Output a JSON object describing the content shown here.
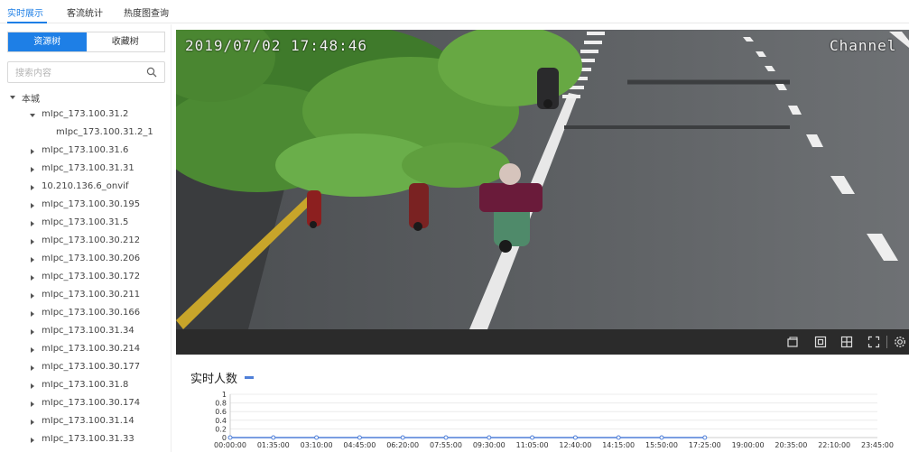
{
  "nav": {
    "tabs": [
      {
        "label": "实时展示",
        "active": true
      },
      {
        "label": "客流统计",
        "active": false
      },
      {
        "label": "热度图查询",
        "active": false
      }
    ]
  },
  "sidebar": {
    "segments": [
      {
        "label": "资源树",
        "active": true
      },
      {
        "label": "收藏树",
        "active": false
      }
    ],
    "search": {
      "placeholder": "搜索内容"
    },
    "tree": [
      {
        "label": "本城",
        "level": 0,
        "expanded": true
      },
      {
        "label": "mIpc_173.100.31.2",
        "level": 1,
        "expanded": true
      },
      {
        "label": "mIpc_173.100.31.2_1",
        "level": 2,
        "leaf": true
      },
      {
        "label": "mIpc_173.100.31.6",
        "level": 1
      },
      {
        "label": "mIpc_173.100.31.31",
        "level": 1
      },
      {
        "label": "10.210.136.6_onvif",
        "level": 1
      },
      {
        "label": "mIpc_173.100.30.195",
        "level": 1
      },
      {
        "label": "mIpc_173.100.31.5",
        "level": 1
      },
      {
        "label": "mIpc_173.100.30.212",
        "level": 1
      },
      {
        "label": "mIpc_173.100.30.206",
        "level": 1
      },
      {
        "label": "mIpc_173.100.30.172",
        "level": 1
      },
      {
        "label": "mIpc_173.100.30.211",
        "level": 1
      },
      {
        "label": "mIpc_173.100.30.166",
        "level": 1
      },
      {
        "label": "mIpc_173.100.31.34",
        "level": 1
      },
      {
        "label": "mIpc_173.100.30.214",
        "level": 1
      },
      {
        "label": "mIpc_173.100.30.177",
        "level": 1
      },
      {
        "label": "mIpc_173.100.31.8",
        "level": 1
      },
      {
        "label": "mIpc_173.100.30.174",
        "level": 1
      },
      {
        "label": "mIpc_173.100.31.14",
        "level": 1
      },
      {
        "label": "mIpc_173.100.31.33",
        "level": 1
      }
    ]
  },
  "video": {
    "timestamp": "2019/07/02 17:48:46",
    "channel": "Channel",
    "toolbar_icons": [
      "window-icon",
      "snapshot-icon",
      "layout-grid-icon",
      "fullscreen-icon",
      "settings-icon"
    ]
  },
  "colors": {
    "accent": "#1e7fe6",
    "series": "#4f7fd8"
  },
  "chart_data": {
    "type": "line",
    "title": "实时人数",
    "yticks": [
      "0",
      "0.2",
      "0.4",
      "0.6",
      "0.8",
      "1"
    ],
    "ylim": [
      0,
      1
    ],
    "x": [
      "00:00:00",
      "01:35:00",
      "03:10:00",
      "04:45:00",
      "06:20:00",
      "07:55:00",
      "09:30:00",
      "11:05:00",
      "12:40:00",
      "14:15:00",
      "15:50:00",
      "17:25:00",
      "19:00:00",
      "20:35:00",
      "22:10:00",
      "23:45:00"
    ],
    "series": [
      {
        "values": [
          0,
          0,
          0,
          0,
          0,
          0,
          0,
          0,
          0,
          0,
          0,
          0,
          null,
          null,
          null,
          null
        ]
      }
    ],
    "grid": true
  }
}
